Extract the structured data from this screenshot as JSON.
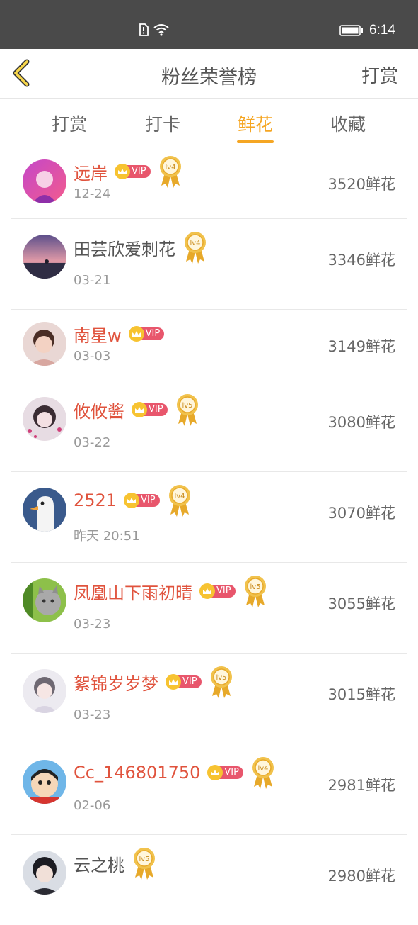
{
  "status_bar": {
    "time": "6:14"
  },
  "header": {
    "title": "粉丝荣誉榜",
    "action": "打赏"
  },
  "tabs": [
    {
      "label": "打赏",
      "active": false
    },
    {
      "label": "打卡",
      "active": false
    },
    {
      "label": "鲜花",
      "active": true
    },
    {
      "label": "收藏",
      "active": false
    }
  ],
  "colors": {
    "accent": "#f5a623",
    "vip_name": "#e0533d",
    "vip_badge": "#e8566c"
  },
  "entries": [
    {
      "name": "远岸",
      "vip": true,
      "level": "lv4",
      "date": "12-24",
      "amount": "3520鲜花"
    },
    {
      "name": "田芸欣爱刺花",
      "vip": false,
      "level": "lv4",
      "date": "03-21",
      "amount": "3346鲜花"
    },
    {
      "name": "南星w",
      "vip": true,
      "level": "",
      "date": "03-03",
      "amount": "3149鲜花"
    },
    {
      "name": "攸攸酱",
      "vip": true,
      "level": "lv5",
      "date": "03-22",
      "amount": "3080鲜花"
    },
    {
      "name": "2521",
      "vip": true,
      "level": "lv4",
      "date": "昨天 20:51",
      "amount": "3070鲜花"
    },
    {
      "name": "凤凰山下雨初晴",
      "vip": true,
      "level": "lv5",
      "date": "03-23",
      "amount": "3055鲜花"
    },
    {
      "name": "絮锦岁岁梦",
      "vip": true,
      "level": "lv5",
      "date": "03-23",
      "amount": "3015鲜花"
    },
    {
      "name": "Cc_146801750",
      "vip": true,
      "level": "lv4",
      "date": "02-06",
      "amount": "2981鲜花"
    },
    {
      "name": "云之桃",
      "vip": false,
      "level": "lv5",
      "date": "",
      "amount": "2980鲜花"
    }
  ],
  "vip_label": "VIP"
}
